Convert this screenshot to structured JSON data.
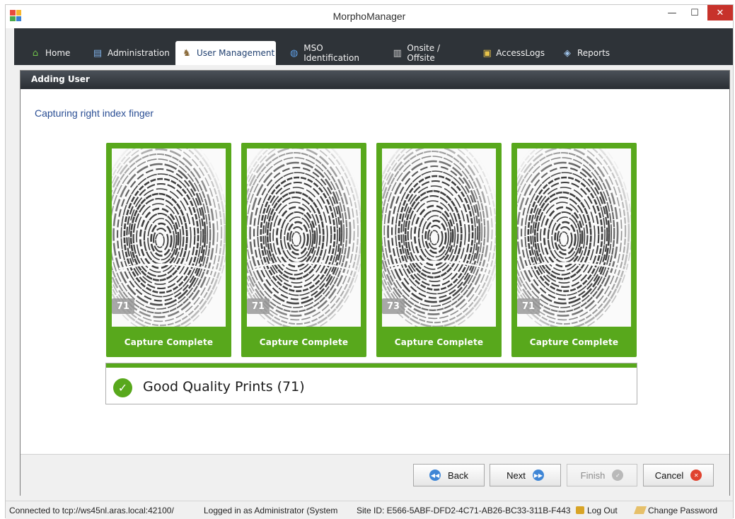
{
  "window": {
    "title": "MorphoManager"
  },
  "tabs": [
    {
      "label": "Home",
      "icon": "home-icon",
      "active": false
    },
    {
      "label": "Administration",
      "icon": "administration-icon",
      "active": false
    },
    {
      "label": "User Management",
      "icon": "user-management-icon",
      "active": true
    },
    {
      "label": "MSO Identification",
      "icon": "globe-icon",
      "active": false
    },
    {
      "label": "Onsite / Offsite",
      "icon": "building-icon",
      "active": false
    },
    {
      "label": "AccessLogs",
      "icon": "access-logs-icon",
      "active": false
    },
    {
      "label": "Reports",
      "icon": "reports-icon",
      "active": false
    }
  ],
  "panel": {
    "title": "Adding User",
    "subtitle": "Capturing right index finger"
  },
  "captures": [
    {
      "score": "71",
      "label": "Capture Complete"
    },
    {
      "score": "71",
      "label": "Capture Complete"
    },
    {
      "score": "73",
      "label": "Capture Complete"
    },
    {
      "score": "71",
      "label": "Capture Complete"
    }
  ],
  "quality": {
    "text": "Good Quality Prints (71)",
    "icon": "check-circle-icon"
  },
  "buttons": {
    "back": "Back",
    "next": "Next",
    "finish": "Finish",
    "cancel": "Cancel"
  },
  "status": {
    "connection": "Connected to tcp://ws45nl.aras.local:42100/",
    "logged_in": "Logged in as Administrator (System",
    "site_id": "Site ID: E566-5ABF-DFD2-4C71-AB26-BC33-311B-F443",
    "log_out": "Log Out",
    "change_password": "Change Password"
  },
  "colors": {
    "accent_green": "#58a81c",
    "tabbar_bg": "#2e3338",
    "subtitle_blue": "#2a4e94",
    "close_red": "#c7322b"
  }
}
